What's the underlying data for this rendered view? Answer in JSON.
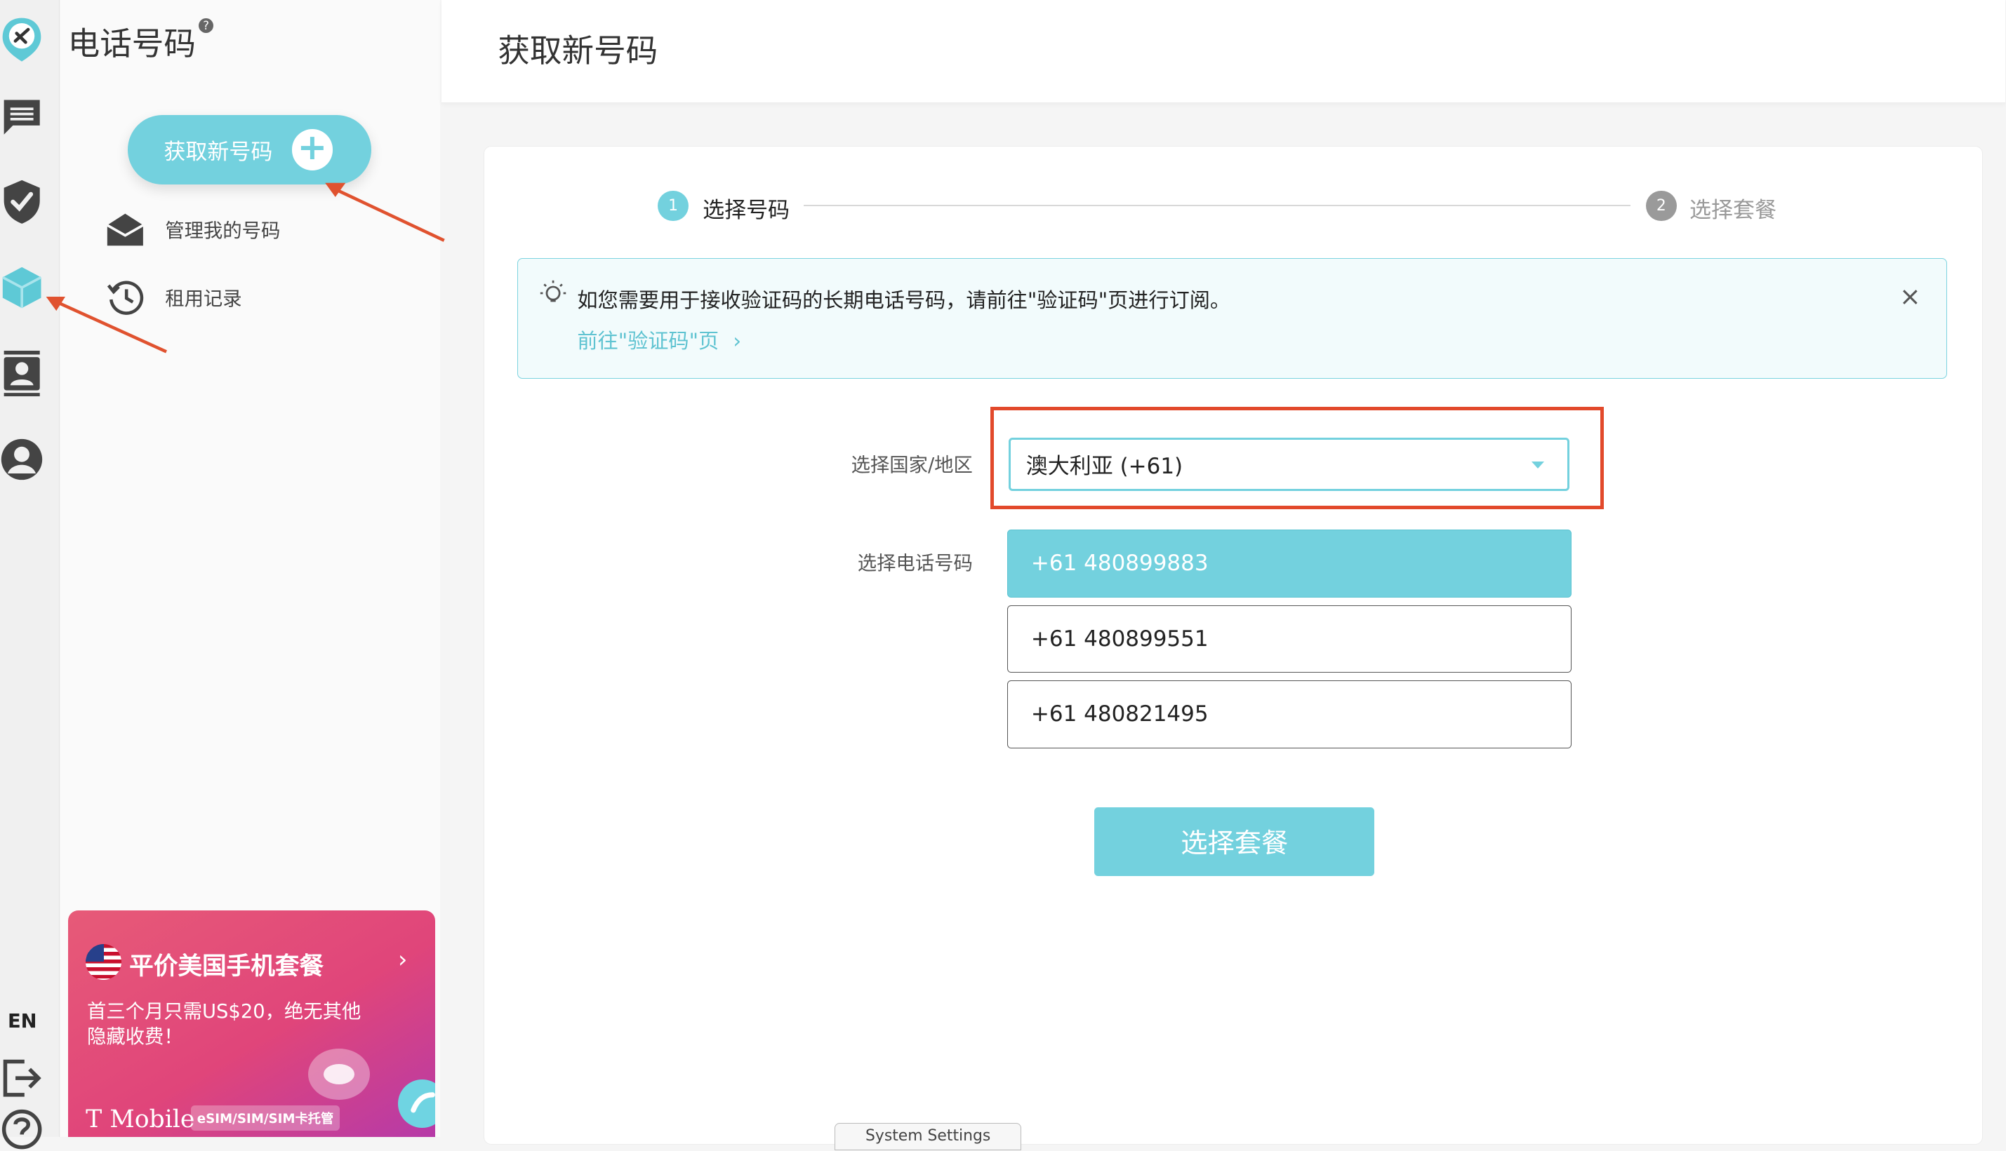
{
  "rail": {
    "lang": "EN",
    "icons": [
      "app-logo-icon",
      "messages-icon",
      "shield-check-icon",
      "cube-icon",
      "contacts-icon",
      "account-icon",
      "logout-icon",
      "help-icon"
    ]
  },
  "panel": {
    "title": "电话号码",
    "help": "?",
    "new_number_button": "获取新号码",
    "menu": [
      {
        "label": "管理我的号码",
        "icon": "mail-open-icon"
      },
      {
        "label": "租用记录",
        "icon": "history-icon"
      }
    ],
    "promo": {
      "title": "平价美国手机套餐",
      "desc_line1": "首三个月只需US$20，绝无其他",
      "desc_line2": "隐藏收费！",
      "brand": "T Mobile",
      "tag": "eSIM/SIM/SIM卡托管"
    }
  },
  "header": {
    "title": "获取新号码"
  },
  "steps": [
    {
      "num": "1",
      "label": "选择号码",
      "active": true
    },
    {
      "num": "2",
      "label": "选择套餐",
      "active": false
    }
  ],
  "alert": {
    "text": "如您需要用于接收验证码的长期电话号码，请前往\"验证码\"页进行订阅。",
    "link": "前往\"验证码\"页"
  },
  "form": {
    "country_label": "选择国家/地区",
    "country_value": "澳大利亚 (+61)",
    "number_label": "选择电话号码",
    "numbers": [
      "+61 480899883",
      "+61 480899551",
      "+61 480821495"
    ],
    "selected_index": 0,
    "submit": "选择套餐"
  },
  "bottom_tab": "System Settings",
  "colors": {
    "accent": "#73d1de",
    "highlight": "#e2492b",
    "arrow": "#e0522f"
  }
}
